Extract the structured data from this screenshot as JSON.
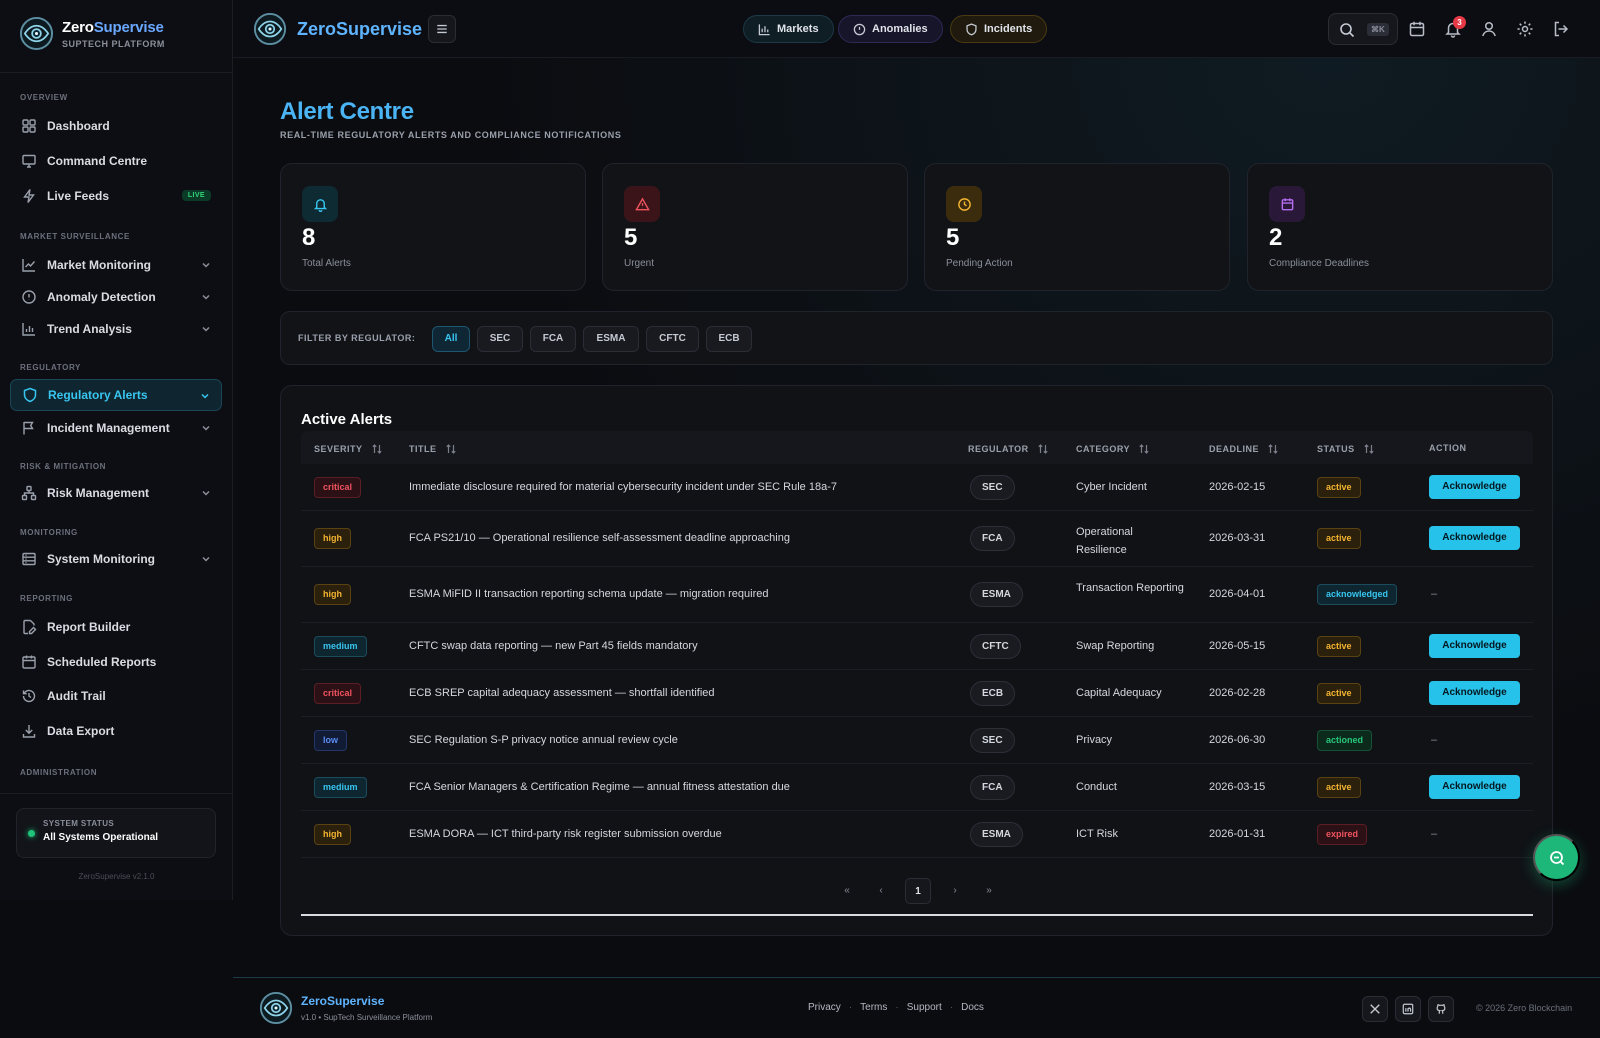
{
  "brand": {
    "name_a": "Zero",
    "name_b": "Supervise",
    "platform": "SUPTECH PLATFORM",
    "full_name": "ZeroSupervise",
    "version": "ZeroSupervise v2.1.0"
  },
  "sidebar": {
    "sections": {
      "overview": "OVERVIEW",
      "market": "MARKET SURVEILLANCE",
      "regulatory": "REGULATORY",
      "risk": "RISK & MITIGATION",
      "monitoring": "MONITORING",
      "reporting": "REPORTING",
      "admin": "ADMINISTRATION"
    },
    "items": {
      "dashboard": "Dashboard",
      "command": "Command Centre",
      "live": "Live Feeds",
      "live_badge": "LIVE",
      "market_monitoring": "Market Monitoring",
      "anomaly": "Anomaly Detection",
      "trend": "Trend Analysis",
      "reg_alerts": "Regulatory Alerts",
      "incident": "Incident Management",
      "risk": "Risk Management",
      "system": "System Monitoring",
      "report_builder": "Report Builder",
      "scheduled": "Scheduled Reports",
      "audit": "Audit Trail",
      "export": "Data Export"
    },
    "status": {
      "label": "SYSTEM STATUS",
      "value": "All Systems Operational"
    }
  },
  "topbar": {
    "markets": "Markets",
    "anomalies": "Anomalies",
    "incidents": "Incidents",
    "search_kbd": "⌘K",
    "notif_count": "3"
  },
  "page": {
    "title": "Alert Centre",
    "subtitle": "REAL-TIME REGULATORY ALERTS AND COMPLIANCE NOTIFICATIONS"
  },
  "stats": [
    {
      "value": "8",
      "label": "Total Alerts"
    },
    {
      "value": "5",
      "label": "Urgent"
    },
    {
      "value": "5",
      "label": "Pending Action"
    },
    {
      "value": "2",
      "label": "Compliance Deadlines"
    }
  ],
  "filter": {
    "label": "FILTER BY REGULATOR:",
    "options": [
      "All",
      "SEC",
      "FCA",
      "ESMA",
      "CFTC",
      "ECB"
    ],
    "selected": "All"
  },
  "table": {
    "title": "Active Alerts",
    "headers": {
      "severity": "SEVERITY",
      "title": "TITLE",
      "regulator": "REGULATOR",
      "category": "CATEGORY",
      "deadline": "DEADLINE",
      "status": "STATUS",
      "action": "ACTION"
    },
    "ack_label": "Acknowledge",
    "dash": "–",
    "rows": [
      {
        "severity": "critical",
        "title": "Immediate disclosure required for material cybersecurity incident under SEC Rule 18a-7",
        "regulator": "SEC",
        "category": "Cyber Incident",
        "deadline": "2026-02-15",
        "status": "active"
      },
      {
        "severity": "high",
        "title": "FCA PS21/10 — Operational resilience self-assessment deadline approaching",
        "regulator": "FCA",
        "category": "Operational Resilience",
        "deadline": "2026-03-31",
        "status": "active"
      },
      {
        "severity": "high",
        "title": "ESMA MiFID II transaction reporting schema update — migration required",
        "regulator": "ESMA",
        "category": "Transaction Reporting",
        "deadline": "2026-04-01",
        "status": "acknowledged"
      },
      {
        "severity": "medium",
        "title": "CFTC swap data reporting — new Part 45 fields mandatory",
        "regulator": "CFTC",
        "category": "Swap Reporting",
        "deadline": "2026-05-15",
        "status": "active"
      },
      {
        "severity": "critical",
        "title": "ECB SREP capital adequacy assessment — shortfall identified",
        "regulator": "ECB",
        "category": "Capital Adequacy",
        "deadline": "2026-02-28",
        "status": "active"
      },
      {
        "severity": "low",
        "title": "SEC Regulation S-P privacy notice annual review cycle",
        "regulator": "SEC",
        "category": "Privacy",
        "deadline": "2026-06-30",
        "status": "actioned"
      },
      {
        "severity": "medium",
        "title": "FCA Senior Managers & Certification Regime — annual fitness attestation due",
        "regulator": "FCA",
        "category": "Conduct",
        "deadline": "2026-03-15",
        "status": "active"
      },
      {
        "severity": "high",
        "title": "ESMA DORA — ICT third-party risk register submission overdue",
        "regulator": "ESMA",
        "category": "ICT Risk",
        "deadline": "2026-01-31",
        "status": "expired"
      }
    ]
  },
  "pagination": {
    "first": "«",
    "prev": "‹",
    "current": "1",
    "next": "›",
    "last": "»"
  },
  "footer": {
    "tagline": "v1.0 • SupTech Surveillance Platform",
    "links": [
      "Privacy",
      "Terms",
      "Support",
      "Docs"
    ],
    "copyright": "© 2026 Zero Blockchain"
  },
  "colors": {
    "accent": "#38c5ef",
    "critical": "#f0535f",
    "high": "#f5b431",
    "low": "#5c8df6",
    "success": "#1fc37a"
  }
}
